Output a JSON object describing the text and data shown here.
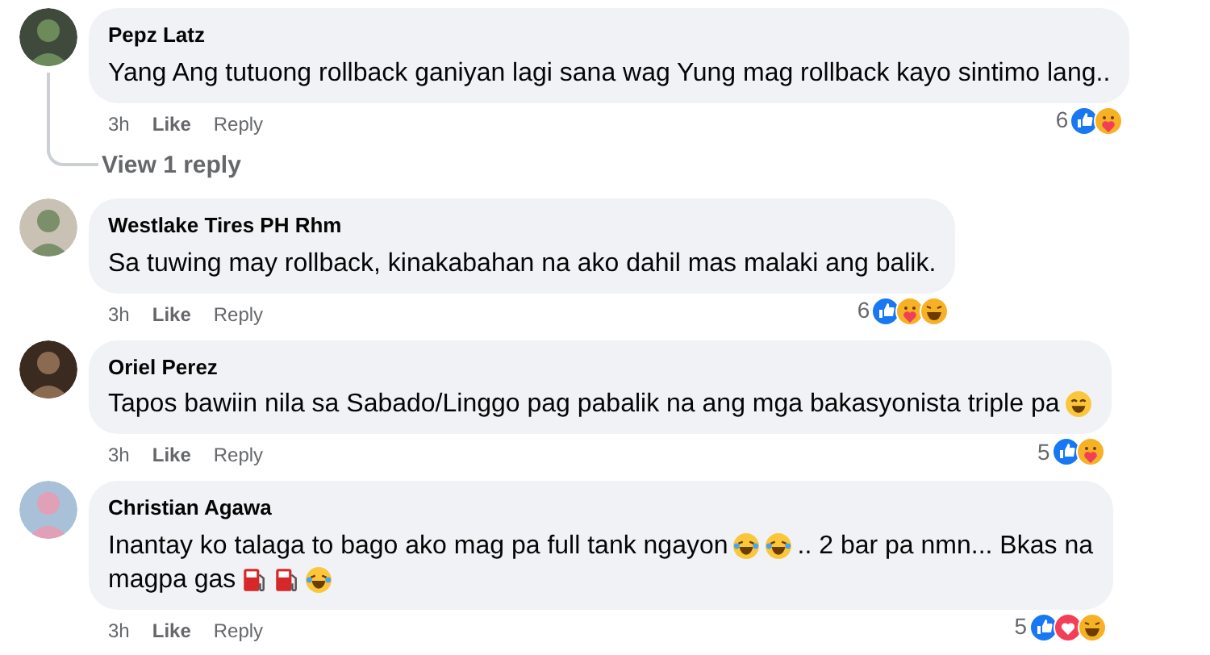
{
  "comments": [
    {
      "author": "Pepz Latz",
      "lines": [
        [
          {
            "kind": "text",
            "text": "Yang Ang tutuong rollback ganiyan lagi sana wag Yung mag rollback kayo sintimo lang.."
          }
        ]
      ],
      "time": "3h",
      "like": "Like",
      "reply": "Reply",
      "reaction_count": "6",
      "reactions": [
        {
          "kind": "like"
        },
        {
          "kind": "care"
        }
      ],
      "view_replies": "View 1 reply"
    },
    {
      "author": "Westlake Tires PH Rhm",
      "lines": [
        [
          {
            "kind": "text",
            "text": "Sa tuwing may rollback, kinakabahan na ako dahil mas malaki ang balik."
          }
        ]
      ],
      "time": "3h",
      "like": "Like",
      "reply": "Reply",
      "reaction_count": "6",
      "reactions": [
        {
          "kind": "like"
        },
        {
          "kind": "care"
        },
        {
          "kind": "haha"
        }
      ]
    },
    {
      "author": "Oriel Perez",
      "lines": [
        [
          {
            "kind": "text",
            "text": "Tapos bawiin nila sa Sabado/Linggo pag pabalik na ang mga bakasyonista triple pa"
          },
          {
            "kind": "grin"
          }
        ]
      ],
      "time": "3h",
      "like": "Like",
      "reply": "Reply",
      "reaction_count": "5",
      "reactions": [
        {
          "kind": "like"
        },
        {
          "kind": "care"
        }
      ]
    },
    {
      "author": "Christian Agawa",
      "lines": [
        [
          {
            "kind": "text",
            "text": "Inantay ko talaga to bago ako mag pa full tank ngayon"
          },
          {
            "kind": "laugh"
          },
          {
            "kind": "laugh"
          },
          {
            "kind": "text",
            "text": ".. 2 bar pa nmn... Bkas na"
          }
        ],
        [
          {
            "kind": "text",
            "text": "magpa gas"
          },
          {
            "kind": "fuel"
          },
          {
            "kind": "fuel"
          },
          {
            "kind": "laugh"
          }
        ]
      ],
      "time": "3h",
      "like": "Like",
      "reply": "Reply",
      "reaction_count": "5",
      "reactions": [
        {
          "kind": "like"
        },
        {
          "kind": "love"
        },
        {
          "kind": "haha"
        }
      ]
    }
  ]
}
